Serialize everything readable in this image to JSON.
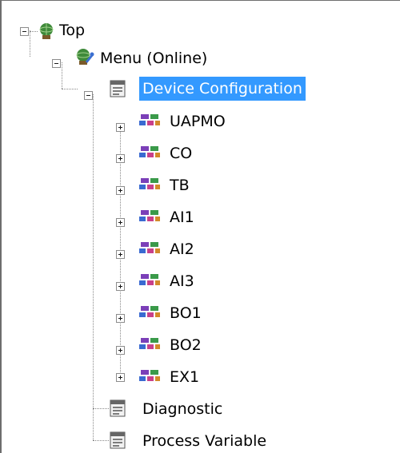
{
  "tree": {
    "top": {
      "label": "Top",
      "icon": "device-globe-icon",
      "state": "expanded"
    },
    "menu": {
      "label": "Menu (Online)",
      "icon": "device-wrench-icon",
      "state": "expanded"
    },
    "device_config": {
      "label": "Device Configuration",
      "icon": "menu-page-icon",
      "state": "expanded",
      "selected": true,
      "children": [
        {
          "label": "UAPMO",
          "icon": "block-icon",
          "state": "collapsed"
        },
        {
          "label": "CO",
          "icon": "block-icon",
          "state": "collapsed"
        },
        {
          "label": "TB",
          "icon": "block-icon",
          "state": "collapsed"
        },
        {
          "label": "AI1",
          "icon": "block-icon",
          "state": "collapsed"
        },
        {
          "label": "AI2",
          "icon": "block-icon",
          "state": "collapsed"
        },
        {
          "label": "AI3",
          "icon": "block-icon",
          "state": "collapsed"
        },
        {
          "label": "BO1",
          "icon": "block-icon",
          "state": "collapsed"
        },
        {
          "label": "BO2",
          "icon": "block-icon",
          "state": "collapsed"
        },
        {
          "label": "EX1",
          "icon": "block-icon",
          "state": "collapsed"
        }
      ]
    },
    "diagnostic": {
      "label": "Diagnostic",
      "icon": "menu-page-icon"
    },
    "process_variable": {
      "label": "Process Variable",
      "icon": "menu-page-icon"
    }
  },
  "colors": {
    "selection": "#3399ff",
    "selection_text": "#ffffff"
  }
}
